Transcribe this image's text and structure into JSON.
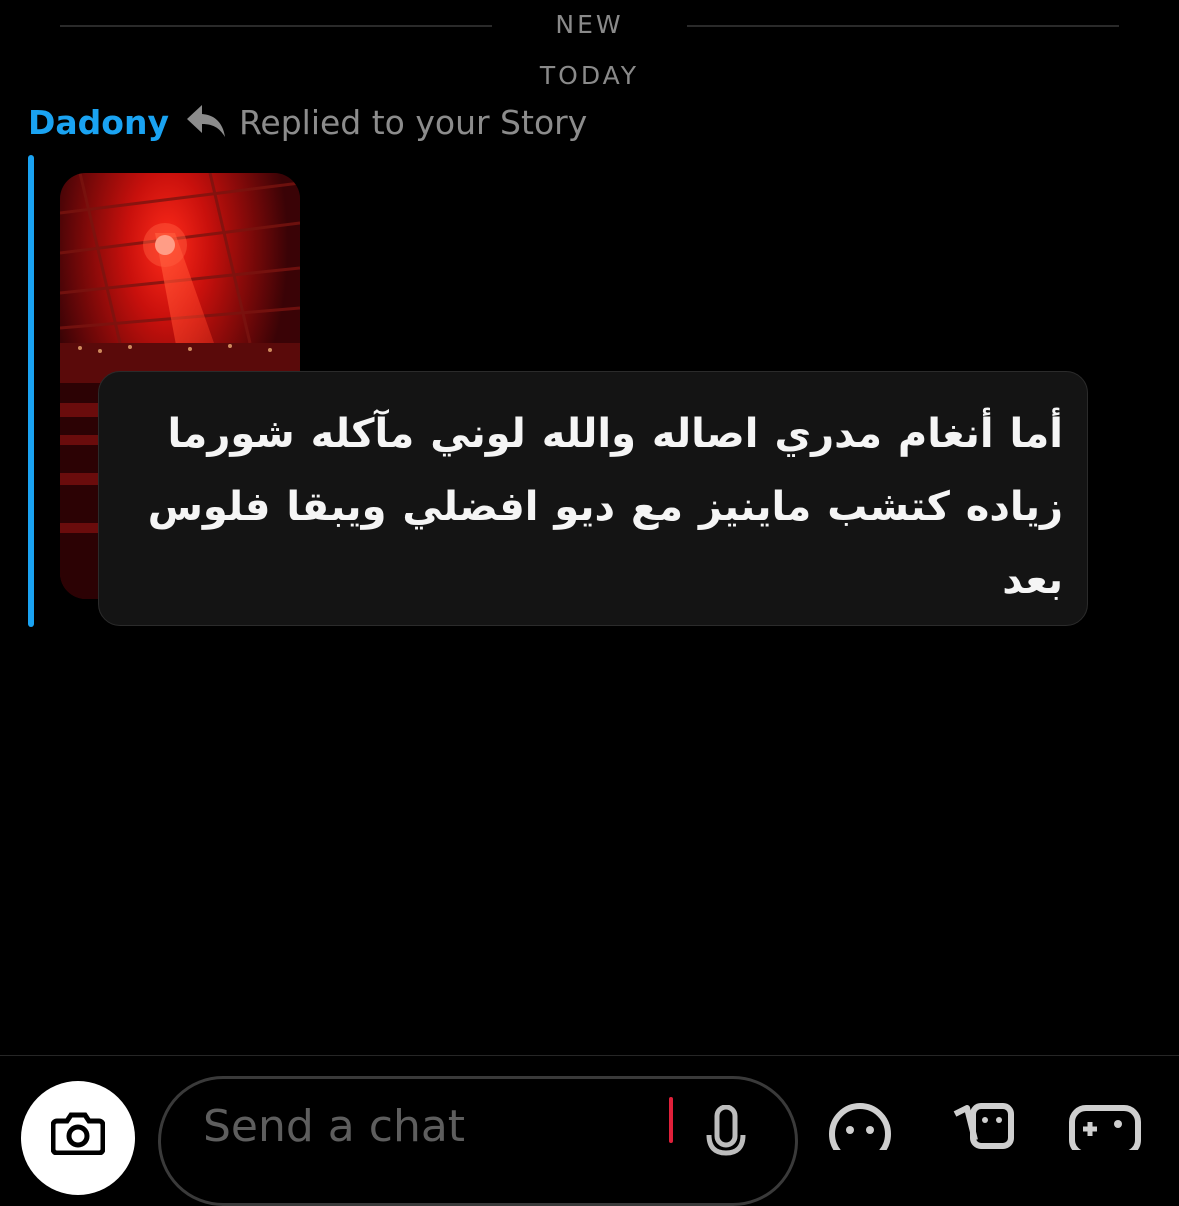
{
  "chat": {
    "new_label": "NEW",
    "day_label": "TODAY",
    "sender_name": "Dadony",
    "reply_status": "Replied to your Story",
    "message_text": "أما أنغام مدري اصاله والله لوني مآكله شورما زياده كتشب ماينيز مع ديو افضلي ويبقا فلوس بعد"
  },
  "composer": {
    "placeholder": "Send a chat"
  },
  "icons": {
    "reply": "reply-arrow-icon",
    "camera": "camera-icon",
    "mic": "microphone-icon",
    "emoji": "emoji-icon",
    "stickers": "stickers-icon",
    "games": "game-controller-icon"
  },
  "colors": {
    "accent": "#1aa3f2",
    "background": "#000000",
    "bubble": "#141414",
    "caret": "#e0203a"
  }
}
